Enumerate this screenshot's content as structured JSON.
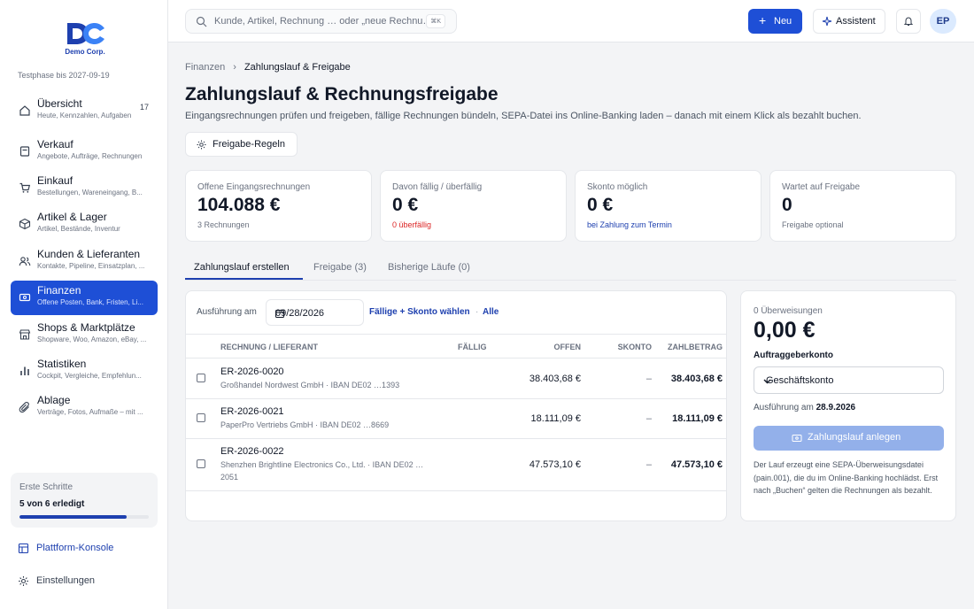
{
  "brand": {
    "logo_text": "Demo Corp.",
    "trial": "Testphase bis 2027-09-19"
  },
  "nav": [
    {
      "label": "Übersicht",
      "sub": "Heute, Kennzahlen, Aufgaben",
      "count": "17"
    },
    {
      "label": "Verkauf",
      "sub": "Angebote, Aufträge, Rechnungen"
    },
    {
      "label": "Einkauf",
      "sub": "Bestellungen, Wareneingang, B..."
    },
    {
      "label": "Artikel & Lager",
      "sub": "Artikel, Bestände, Inventur"
    },
    {
      "label": "Kunden & Lieferanten",
      "sub": "Kontakte, Pipeline, Einsatzplan, ..."
    },
    {
      "label": "Finanzen",
      "sub": "Offene Posten, Bank, Fristen, Li..."
    },
    {
      "label": "Shops & Marktplätze",
      "sub": "Shopware, Woo, Amazon, eBay, ..."
    },
    {
      "label": "Statistiken",
      "sub": "Cockpit, Vergleiche, Empfehlun..."
    },
    {
      "label": "Ablage",
      "sub": "Verträge, Fotos, Aufmaße – mit ..."
    }
  ],
  "steps": {
    "title": "Erste Schritte",
    "status": "5 von 6 erledigt",
    "progress": 0.83
  },
  "sidebar_links": {
    "platform": "Plattform-Konsole",
    "settings": "Einstellungen"
  },
  "topbar": {
    "search_placeholder": "Kunde, Artikel, Rechnung … oder „neue Rechnu…",
    "shortcut": "⌘K",
    "new_label": "Neu",
    "assistant_label": "Assistent",
    "avatar": "EP"
  },
  "breadcrumb": {
    "parent": "Finanzen",
    "current": "Zahlungslauf & Freigabe"
  },
  "page": {
    "title": "Zahlungslauf & Rechnungsfreigabe",
    "subtitle": "Eingangsrechnungen prüfen und freigeben, fällige Rechnungen bündeln, SEPA-Datei ins Online-Banking laden – danach mit einem Klick als bezahlt buchen.",
    "rules_button": "Freigabe-Regeln"
  },
  "kpis": [
    {
      "label": "Offene Eingangsrechnungen",
      "value": "104.088 €",
      "note": "3 Rechnungen"
    },
    {
      "label": "Davon fällig / überfällig",
      "value": "0 €",
      "note": "0 überfällig"
    },
    {
      "label": "Skonto möglich",
      "value": "0 €",
      "note": "bei Zahlung zum Termin"
    },
    {
      "label": "Wartet auf Freigabe",
      "value": "0",
      "note": "Freigabe optional"
    }
  ],
  "tabs": [
    "Zahlungslauf erstellen",
    "Freigabe (3)",
    "Bisherige Läufe (0)"
  ],
  "run": {
    "exec_label": "Ausführung am",
    "date": "09/28/2026",
    "quick_due": "Fällige + Skonto wählen",
    "quick_all": "Alle",
    "dot": "·"
  },
  "table": {
    "headers": {
      "invoice": "RECHNUNG / LIEFERANT",
      "due": "FÄLLIG",
      "open": "OFFEN",
      "discount": "SKONTO",
      "amount": "ZAHLBETRAG"
    },
    "rows": [
      {
        "number": "ER-2026-0020",
        "supplier": "Großhandel Nordwest GmbH · IBAN DE02 …1393",
        "due": "",
        "open": "38.403,68 €",
        "discount": "–",
        "amount": "38.403,68 €"
      },
      {
        "number": "ER-2026-0021",
        "supplier": "PaperPro Vertriebs GmbH · IBAN DE02 …8669",
        "due": "",
        "open": "18.111,09 €",
        "discount": "–",
        "amount": "18.111,09 €"
      },
      {
        "number": "ER-2026-0022",
        "supplier": "Shenzhen Brightline Electronics Co., Ltd. · IBAN DE02 … 2051",
        "due": "",
        "open": "47.573,10 €",
        "discount": "–",
        "amount": "47.573,10 €"
      }
    ]
  },
  "summary": {
    "count": "0 Überweisungen",
    "total": "0,00 €",
    "account_label": "Auftraggeberkonto",
    "account_value": "Geschäftskonto",
    "exec_prefix": "Ausführung am",
    "exec_date": "28.9.2026",
    "create_button": "Zahlungslauf anlegen",
    "hint": "Der Lauf erzeugt eine SEPA-Überweisungsdatei (pain.001), die du im Online-Banking hochlädst. Erst nach „Buchen“ gelten die Rechnungen als bezahlt."
  },
  "colors": {
    "primary": "#1e4fd6",
    "primary_dark": "#1e40af",
    "danger": "#dc2626",
    "disabled_button": "#93b0ea"
  },
  "icons": {
    "nav": [
      "home-icon",
      "receipt-icon",
      "cart-icon",
      "box-icon",
      "users-icon",
      "wallet-icon",
      "store-icon",
      "chart-icon",
      "paperclip-icon"
    ],
    "other": [
      "search-icon",
      "plus-icon",
      "sparkle-icon",
      "bell-icon",
      "gear-icon",
      "grid-icon",
      "calendar-icon",
      "chevron-down-icon"
    ]
  }
}
